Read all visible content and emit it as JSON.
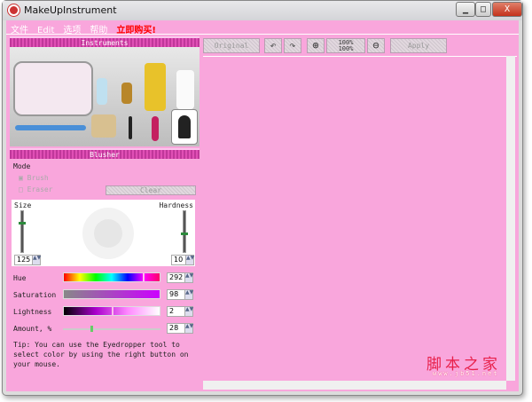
{
  "window": {
    "title": "MakeUpInstrument",
    "min": "▁",
    "max": "□",
    "close": "X"
  },
  "menu": [
    "文件",
    "Edit",
    "选项",
    "帮助",
    "立即购买!"
  ],
  "instruments": {
    "header": "Instruments"
  },
  "toolbar": {
    "original": "Original",
    "undo": "↶",
    "redo": "↷",
    "zoom_in": "⊕",
    "zoom_100_top": "100%",
    "zoom_100_bottom": "100%",
    "zoom_out": "⊖",
    "apply": "Apply"
  },
  "blusher": {
    "header": "Blusher",
    "mode_label": "Mode",
    "brush": "Brush",
    "eraser": "Eraser",
    "brush_checked": true,
    "eraser_checked": false,
    "clear": "Clear",
    "size_label": "Size",
    "size": "125",
    "hardness_label": "Hardness",
    "hardness": "10",
    "hue_label": "Hue",
    "hue": "292",
    "saturation_label": "Saturation",
    "saturation": "98",
    "lightness_label": "Lightness",
    "lightness": "2",
    "amount_label": "Amount, %",
    "amount": "28",
    "tip": "Tip: You can use the Eyedropper tool to select color by using the right button on your mouse."
  },
  "watermark": {
    "main": "脚本之家",
    "sub": "www.jb51.net"
  }
}
